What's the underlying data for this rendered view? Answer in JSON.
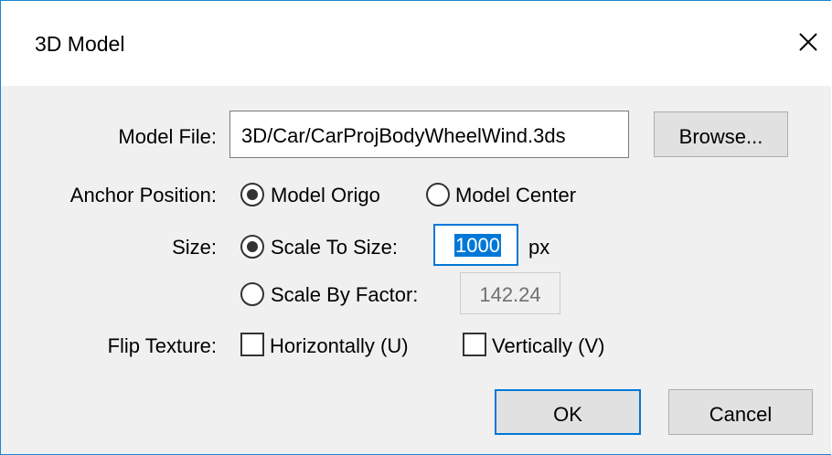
{
  "window": {
    "title": "3D Model"
  },
  "model_file": {
    "label": "Model File:",
    "value": "3D/Car/CarProjBodyWheelWind.3ds",
    "browse_label": "Browse..."
  },
  "anchor": {
    "label": "Anchor Position:",
    "options": [
      "Model Origo",
      "Model Center"
    ],
    "selected": "Model Origo"
  },
  "size": {
    "label": "Size:",
    "scale_to_size_label": "Scale To Size:",
    "scale_to_size_value": "1000",
    "unit": "px",
    "scale_by_factor_label": "Scale By Factor:",
    "scale_by_factor_value": "142.24",
    "selected": "Scale To Size"
  },
  "flip_texture": {
    "label": "Flip Texture:",
    "horizontal_label": "Horizontally (U)",
    "vertical_label": "Vertically (V)",
    "horizontal_checked": false,
    "vertical_checked": false
  },
  "buttons": {
    "ok": "OK",
    "cancel": "Cancel"
  },
  "icons": {
    "close": "close-icon"
  },
  "colors": {
    "accent": "#0078d7",
    "window_border": "#1b86cc",
    "background": "#f0f0f0"
  }
}
